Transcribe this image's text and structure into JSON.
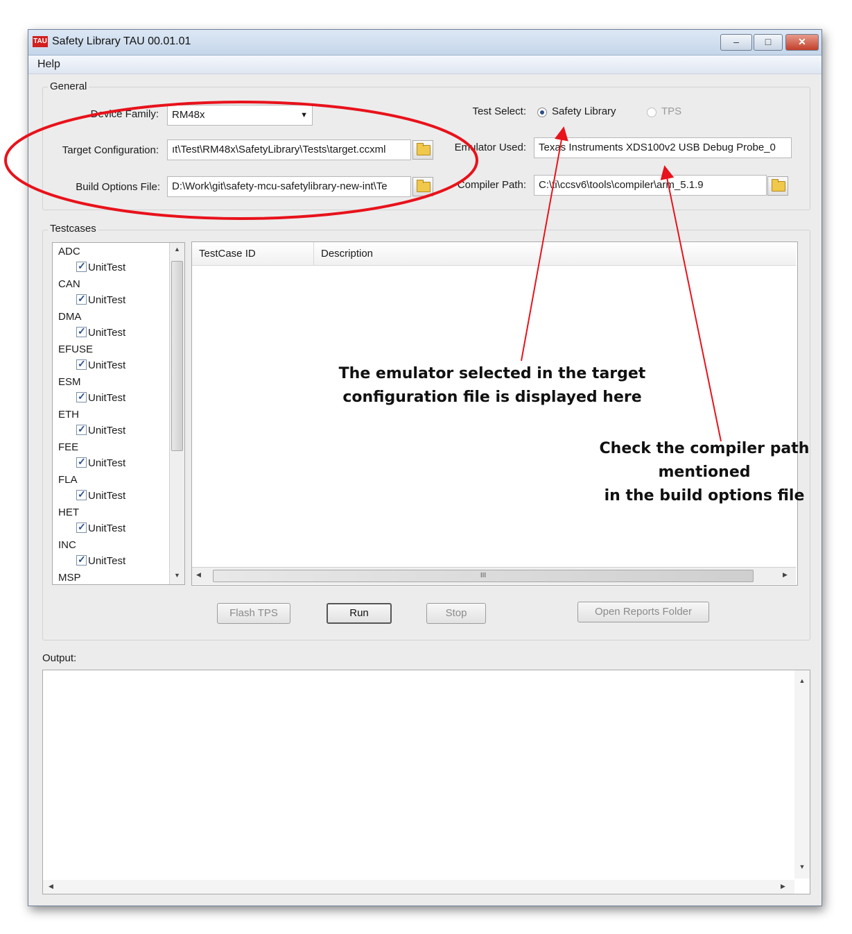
{
  "window": {
    "title": "Safety Library TAU 00.01.01",
    "logo_text": "TAU",
    "controls": {
      "minimize": "–",
      "maximize": "□",
      "close": "✕"
    }
  },
  "menu": {
    "help": "Help"
  },
  "general": {
    "group_label": "General",
    "device_family": {
      "label": "Device Family:",
      "value": "RM48x"
    },
    "target_configuration": {
      "label": "Target Configuration:",
      "value": "ıt\\Test\\RM48x\\SafetyLibrary\\Tests\\target.ccxml"
    },
    "build_options_file": {
      "label": "Build Options File:",
      "value": "D:\\Work\\git\\safety-mcu-safetylibrary-new-int\\Te"
    },
    "test_select": {
      "label": "Test Select:",
      "options": [
        "Safety Library",
        "TPS"
      ],
      "selected": "Safety Library"
    },
    "emulator_used": {
      "label": "Emulator Used:",
      "value": "Texas Instruments XDS100v2 USB Debug Probe_0"
    },
    "compiler_path": {
      "label": "Compiler Path:",
      "value": "C:\\ti\\ccsv6\\tools\\compiler\\arm_5.1.9"
    }
  },
  "testcases": {
    "group_label": "Testcases",
    "tree": [
      {
        "module": "ADC",
        "child": "UnitTest",
        "checked": true
      },
      {
        "module": "CAN",
        "child": "UnitTest",
        "checked": true
      },
      {
        "module": "DMA",
        "child": "UnitTest",
        "checked": true
      },
      {
        "module": "EFUSE",
        "child": "UnitTest",
        "checked": true
      },
      {
        "module": "ESM",
        "child": "UnitTest",
        "checked": true
      },
      {
        "module": "ETH",
        "child": "UnitTest",
        "checked": true
      },
      {
        "module": "FEE",
        "child": "UnitTest",
        "checked": true
      },
      {
        "module": "FLA",
        "child": "UnitTest",
        "checked": true
      },
      {
        "module": "HET",
        "child": "UnitTest",
        "checked": true
      },
      {
        "module": "INC",
        "child": "UnitTest",
        "checked": true
      },
      {
        "module": "MSP"
      }
    ],
    "table_columns": [
      "TestCase ID",
      "Description"
    ],
    "scroll_grip": "III",
    "buttons": {
      "flash_tps": "Flash TPS",
      "run": "Run",
      "stop": "Stop",
      "open_reports": "Open Reports Folder"
    }
  },
  "output": {
    "label": "Output:",
    "content": ""
  },
  "annotations": {
    "emulator_note": [
      "The emulator selected in the target",
      "configuration file is displayed here"
    ],
    "compiler_note": [
      "Check the compiler path mentioned",
      "in the build options file"
    ],
    "color": "#e8121b"
  }
}
